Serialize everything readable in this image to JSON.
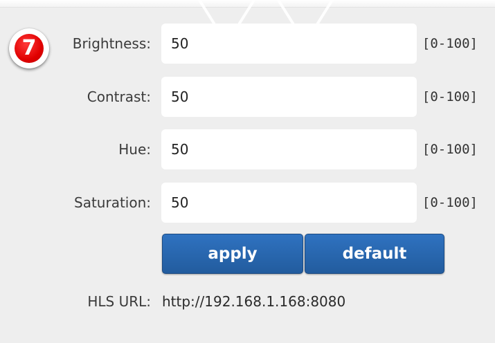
{
  "step_badge": "7",
  "fields": [
    {
      "label": "Brightness:",
      "value": "50",
      "range": "[0-100]"
    },
    {
      "label": "Contrast:",
      "value": "50",
      "range": "[0-100]"
    },
    {
      "label": "Hue:",
      "value": "50",
      "range": "[0-100]"
    },
    {
      "label": "Saturation:",
      "value": "50",
      "range": "[0-100]"
    }
  ],
  "buttons": {
    "apply": "apply",
    "default": "default"
  },
  "hls": {
    "label": "HLS URL:",
    "value": "http://192.168.1.168:8080"
  },
  "colors": {
    "button": "#2a66ae",
    "badge": "#e00000",
    "background": "#eeeeee"
  }
}
